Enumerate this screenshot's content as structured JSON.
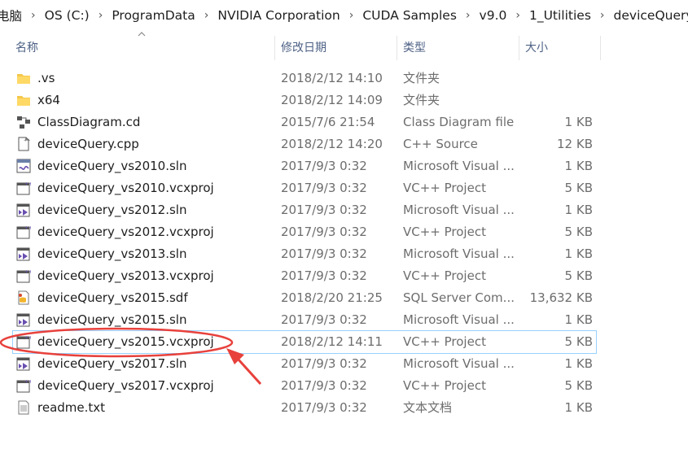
{
  "breadcrumb": [
    "电脑",
    "OS (C:)",
    "ProgramData",
    "NVIDIA Corporation",
    "CUDA Samples",
    "v9.0",
    "1_Utilities",
    "deviceQuery"
  ],
  "columns": {
    "name": "名称",
    "date": "修改日期",
    "type": "类型",
    "size": "大小"
  },
  "files": [
    {
      "name": ".vs",
      "date": "2018/2/12 14:10",
      "type": "文件夹",
      "size": "",
      "icon": "folder-icon"
    },
    {
      "name": "x64",
      "date": "2018/2/12 14:09",
      "type": "文件夹",
      "size": "",
      "icon": "folder-icon"
    },
    {
      "name": "ClassDiagram.cd",
      "date": "2015/7/6 21:54",
      "type": "Class Diagram file",
      "size": "1 KB",
      "icon": "class-diagram-icon"
    },
    {
      "name": "deviceQuery.cpp",
      "date": "2018/2/12 14:20",
      "type": "C++ Source",
      "size": "12 KB",
      "icon": "cpp-file-icon"
    },
    {
      "name": "deviceQuery_vs2010.sln",
      "date": "2017/9/3 0:32",
      "type": "Microsoft Visual ...",
      "size": "1 KB",
      "icon": "vs2010-solution-icon"
    },
    {
      "name": "deviceQuery_vs2010.vcxproj",
      "date": "2017/9/3 0:32",
      "type": "VC++ Project",
      "size": "5 KB",
      "icon": "vcxproj-icon"
    },
    {
      "name": "deviceQuery_vs2012.sln",
      "date": "2017/9/3 0:32",
      "type": "Microsoft Visual ...",
      "size": "1 KB",
      "icon": "vs-solution-icon"
    },
    {
      "name": "deviceQuery_vs2012.vcxproj",
      "date": "2017/9/3 0:32",
      "type": "VC++ Project",
      "size": "5 KB",
      "icon": "vcxproj-icon"
    },
    {
      "name": "deviceQuery_vs2013.sln",
      "date": "2017/9/3 0:32",
      "type": "Microsoft Visual ...",
      "size": "1 KB",
      "icon": "vs-solution-icon"
    },
    {
      "name": "deviceQuery_vs2013.vcxproj",
      "date": "2017/9/3 0:32",
      "type": "VC++ Project",
      "size": "5 KB",
      "icon": "vcxproj-icon"
    },
    {
      "name": "deviceQuery_vs2015.sdf",
      "date": "2018/2/20 21:25",
      "type": "SQL Server Com...",
      "size": "13,632 KB",
      "icon": "sql-database-icon"
    },
    {
      "name": "deviceQuery_vs2015.sln",
      "date": "2017/9/3 0:32",
      "type": "Microsoft Visual ...",
      "size": "1 KB",
      "icon": "vs-solution-icon"
    },
    {
      "name": "deviceQuery_vs2015.vcxproj",
      "date": "2018/2/12 14:11",
      "type": "VC++ Project",
      "size": "5 KB",
      "icon": "vcxproj-icon"
    },
    {
      "name": "deviceQuery_vs2017.sln",
      "date": "2017/9/3 0:32",
      "type": "Microsoft Visual ...",
      "size": "1 KB",
      "icon": "vs-solution-icon"
    },
    {
      "name": "deviceQuery_vs2017.vcxproj",
      "date": "2017/9/3 0:32",
      "type": "VC++ Project",
      "size": "5 KB",
      "icon": "vcxproj-icon"
    },
    {
      "name": "readme.txt",
      "date": "2017/9/3 0:32",
      "type": "文本文档",
      "size": "1 KB",
      "icon": "text-file-icon"
    }
  ],
  "selected_index": 12,
  "colors": {
    "header_text": "#4d6185",
    "annotation": "#e8413c",
    "selection_border": "#99d1ff"
  }
}
